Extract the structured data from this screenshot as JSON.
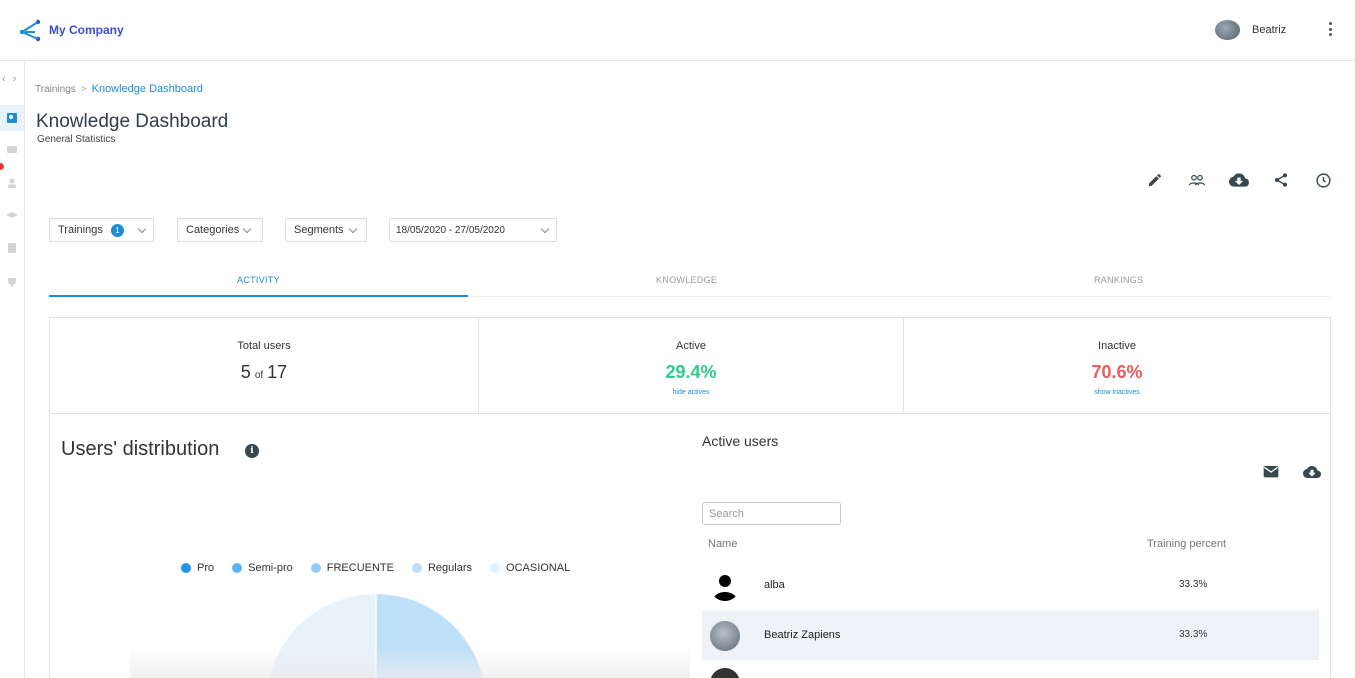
{
  "header": {
    "brand": "My Company",
    "user_name": "Beatriz"
  },
  "sidebar": {
    "nav_arrows": "‹ ›",
    "icons": [
      "dashboard-icon",
      "chat-icon",
      "user-icon",
      "graduation-icon",
      "clipboard-icon",
      "trophy-icon"
    ]
  },
  "breadcrumb": {
    "parent": "Trainings",
    "separator": ">",
    "current": "Knowledge Dashboard"
  },
  "page": {
    "title": "Knowledge Dashboard",
    "subtitle": "General Statistics"
  },
  "actions": [
    "edit-icon",
    "group-icon",
    "cloud-download-icon",
    "share-icon",
    "history-icon"
  ],
  "filters": {
    "trainings": {
      "label": "Trainings",
      "count": "1"
    },
    "categories": {
      "label": "Categories"
    },
    "segments": {
      "label": "Segments"
    },
    "date_range": {
      "value": "18/05/2020 - 27/05/2020"
    }
  },
  "tabs": [
    {
      "label": "ACTIVITY",
      "active": true
    },
    {
      "label": "KNOWLEDGE",
      "active": false
    },
    {
      "label": "RANKINGS",
      "active": false
    }
  ],
  "stats": {
    "total": {
      "label": "Total users",
      "value": "5",
      "of": "of",
      "total": "17"
    },
    "active": {
      "label": "Active",
      "value": "29.4%",
      "link": "hide actives",
      "color": "#2ecc8a"
    },
    "inactive": {
      "label": "Inactive",
      "value": "70.6%",
      "link": "show inactives",
      "color": "#ef5b5b"
    }
  },
  "distribution": {
    "title": "Users' distribution",
    "info": "i",
    "legend": [
      {
        "name": "Pro",
        "color": "#1e96f0"
      },
      {
        "name": "Semi-pro",
        "color": "#5ab5f2"
      },
      {
        "name": "FRECUENTE",
        "color": "#92cdf6"
      },
      {
        "name": "Regulars",
        "color": "#bfe0f9"
      },
      {
        "name": "OCASIONAL",
        "color": "#e3f1fc"
      }
    ]
  },
  "active_users": {
    "title": "Active users",
    "search_placeholder": "Search",
    "columns": {
      "name": "Name",
      "percent": "Training percent"
    },
    "rows": [
      {
        "name": "alba",
        "percent": "33.3%"
      },
      {
        "name": "Beatriz Zapiens",
        "percent": "33.3%"
      }
    ]
  }
}
